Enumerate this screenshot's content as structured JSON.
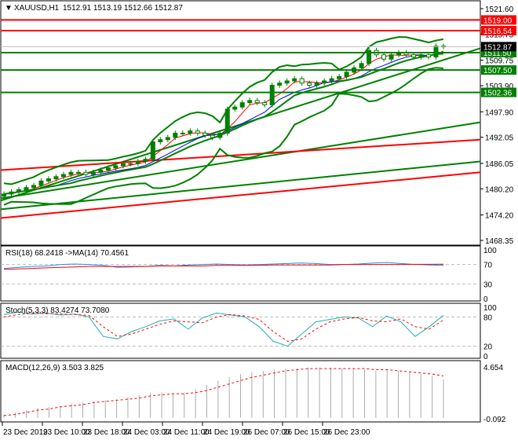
{
  "header": {
    "symbol": "XAUUSD,H1",
    "ohlc": "1512.91 1513.19 1512.66 1512.87"
  },
  "colors": {
    "bull": "#008000",
    "bear": "#ffffff",
    "levelRed": "#ff0000",
    "levelGreen": "#008000",
    "rsi": "#1e90ff",
    "ma": "#ff0000",
    "stoch": "#20b2aa",
    "signal": "#ff0000"
  },
  "chart_data": [
    {
      "type": "candlestick",
      "title": "XAUUSD,H1",
      "ylim": [
        1468.35,
        1521.6
      ],
      "yticks": [
        "1521.60",
        "1515.75",
        "1509.75",
        "1503.90",
        "1497.90",
        "1492.05",
        "1486.05",
        "1480.20",
        "1474.20",
        "1468.35"
      ],
      "xticks": [
        "23 Dec 2019",
        "23 Dec 10:00",
        "23 Dec 18:00",
        "24 Dec 03:00",
        "24 Dec 11:00",
        "24 Dec 19:00",
        "26 Dec 07:00",
        "26 Dec 15:00",
        "26 Dec 23:00"
      ],
      "closes": [
        1479,
        1479.5,
        1480,
        1480.5,
        1481,
        1482,
        1482.5,
        1483,
        1483.5,
        1484,
        1484,
        1483.5,
        1484,
        1484.5,
        1485,
        1485.5,
        1486,
        1486,
        1486.5,
        1487,
        1491,
        1491.5,
        1492,
        1493,
        1493,
        1493.5,
        1493,
        1492.5,
        1492,
        1493,
        1498.5,
        1499,
        1500,
        1500.5,
        1500,
        1499.5,
        1504,
        1504.5,
        1505,
        1505.5,
        1504.5,
        1504,
        1504.5,
        1505,
        1505.5,
        1506,
        1507,
        1508,
        1509,
        1512,
        1511,
        1510,
        1511,
        1511.5,
        1511,
        1510.5,
        1511,
        1510.5,
        1513,
        1512.87
      ],
      "levels": [
        {
          "label": "1519.00",
          "value": 1519.0,
          "color": "red"
        },
        {
          "label": "1516.54",
          "value": 1516.54,
          "color": "red"
        },
        {
          "label": "1511.50",
          "value": 1511.5,
          "color": "green"
        },
        {
          "label": "1507.50",
          "value": 1507.5,
          "color": "green"
        },
        {
          "label": "1502.36",
          "value": 1502.36,
          "color": "green"
        }
      ],
      "current_price": "1512.87",
      "trendlines": [
        {
          "color": "green",
          "from": 1477.5,
          "to": 1512.5
        },
        {
          "color": "green",
          "from": 1478,
          "to": 1495.5
        },
        {
          "color": "red",
          "from": 1484.5,
          "to": 1491.5
        },
        {
          "color": "green",
          "from": 1475.5,
          "to": 1486.5
        },
        {
          "color": "red",
          "from": 1473.5,
          "to": 1484
        }
      ]
    },
    {
      "type": "line",
      "title": "RSI(18) 68.2418 ->MA(14) 70.4561",
      "ylim": [
        0,
        100
      ],
      "yticks": [
        "100",
        "70",
        "30",
        "0"
      ],
      "rsi": [
        62,
        64,
        66,
        67,
        70,
        71,
        70,
        68,
        64,
        65,
        66,
        68,
        67,
        69,
        70,
        71,
        70,
        69,
        70,
        71,
        72,
        73,
        72,
        70,
        70,
        71,
        73,
        74,
        72,
        70,
        69,
        68.24
      ],
      "ma": [
        60,
        61,
        62,
        63,
        64,
        65,
        66,
        66,
        66,
        66,
        66,
        67,
        67,
        67,
        67,
        68,
        68,
        68,
        68,
        69,
        69,
        69,
        69,
        69,
        70,
        70,
        70,
        70,
        70,
        70.3,
        70.4,
        70.46
      ]
    },
    {
      "type": "line",
      "title": "Stoch(5,3,3) 83.4274 73.7080",
      "ylim": [
        0,
        100
      ],
      "yticks": [
        "100",
        "80",
        "20",
        "0"
      ],
      "main": [
        85,
        90,
        86,
        88,
        84,
        86,
        80,
        40,
        35,
        50,
        60,
        72,
        76,
        55,
        78,
        88,
        84,
        80,
        60,
        30,
        20,
        45,
        70,
        75,
        80,
        78,
        60,
        82,
        70,
        40,
        60,
        83.43
      ],
      "signal": [
        80,
        85,
        88,
        87,
        86,
        85,
        83,
        60,
        40,
        45,
        55,
        65,
        72,
        70,
        68,
        80,
        85,
        82,
        75,
        50,
        30,
        35,
        55,
        70,
        76,
        79,
        72,
        70,
        76,
        60,
        55,
        73.71
      ]
    },
    {
      "type": "bar",
      "title": "MACD(12,26,9) 3.503 3.825",
      "ylim": [
        -0.092,
        4.654
      ],
      "yticks": [
        "4.654",
        "-0.092"
      ],
      "macd": [
        0.3,
        0.5,
        0.7,
        0.9,
        1.0,
        1.1,
        1.3,
        1.4,
        1.5,
        1.6,
        1.7,
        1.9,
        2.1,
        2.3,
        2.3,
        2.2,
        2.3,
        2.6,
        3.0,
        3.4,
        3.7,
        4.0,
        4.2,
        4.3,
        4.4,
        4.5,
        4.5,
        4.6,
        4.6,
        4.6,
        4.5,
        4.5,
        4.4,
        4.3,
        4.4,
        4.3,
        4.2,
        4.0,
        3.8,
        3.503
      ],
      "signal": [
        0.2,
        0.3,
        0.5,
        0.7,
        0.8,
        1.0,
        1.1,
        1.2,
        1.4,
        1.5,
        1.6,
        1.7,
        1.8,
        2.0,
        2.1,
        2.2,
        2.2,
        2.3,
        2.5,
        2.8,
        3.1,
        3.4,
        3.7,
        3.9,
        4.1,
        4.3,
        4.4,
        4.5,
        4.5,
        4.5,
        4.5,
        4.5,
        4.5,
        4.4,
        4.4,
        4.3,
        4.2,
        4.1,
        4.0,
        3.825
      ]
    }
  ]
}
